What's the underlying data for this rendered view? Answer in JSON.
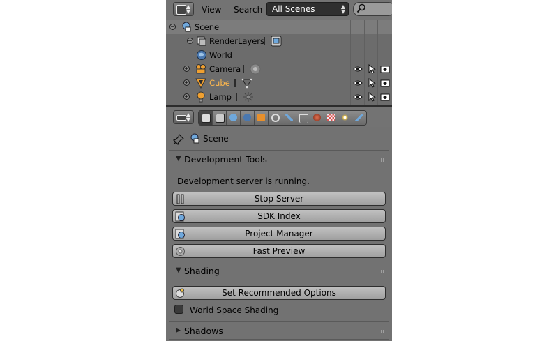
{
  "outliner": {
    "header": {
      "view_label": "View",
      "search_label": "Search",
      "display_mode": "All Scenes"
    },
    "tree": {
      "scene_label": "Scene",
      "renderlayers_label": "RenderLayers",
      "world_label": "World",
      "camera_label": "Camera",
      "cube_label": "Cube",
      "lamp_label": "Lamp"
    }
  },
  "properties": {
    "context_tabs": [
      "render",
      "render-layers",
      "scene",
      "world",
      "object",
      "constraints",
      "modifiers",
      "data",
      "material",
      "texture",
      "particles",
      "physics"
    ],
    "active_tab": "render",
    "breadcrumb_label": "Scene",
    "dev_tools": {
      "title": "Development Tools",
      "status": "Development server is running.",
      "stop_server": "Stop Server",
      "sdk_index": "SDK Index",
      "project_manager": "Project Manager",
      "fast_preview": "Fast Preview"
    },
    "shading": {
      "title": "Shading",
      "set_recommended": "Set Recommended Options",
      "world_space_shading": "World Space Shading",
      "world_space_checked": false
    },
    "shadows": {
      "title": "Shadows"
    }
  },
  "colors": {
    "active_object_text": "#ffb84d",
    "panel_bg": "#727272"
  }
}
